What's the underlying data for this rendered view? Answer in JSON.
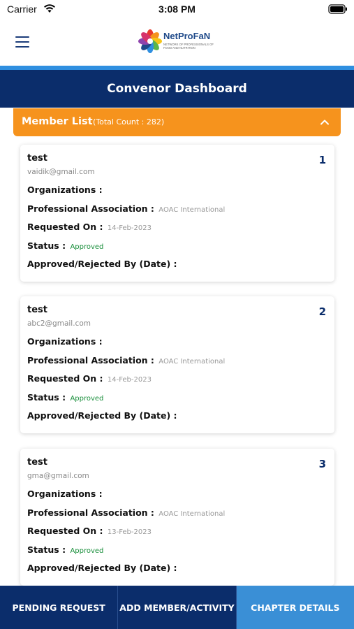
{
  "status_bar": {
    "carrier": "Carrier",
    "time": "3:08 PM"
  },
  "header": {
    "logo_title": "NetProFaN",
    "logo_subtitle": "NETWORK OF PROFESSIONALS OF FOOD AND NUTRITION"
  },
  "title": "Convenor Dashboard",
  "member_list": {
    "label": "Member List",
    "count_text": "(Total Count : 282)",
    "field_labels": {
      "organizations": "Organizations :",
      "professional_association": "Professional Association :",
      "requested_on": "Requested On :",
      "status": "Status :",
      "approved_by": "Approved/Rejected By (Date) :"
    },
    "members": [
      {
        "index": "1",
        "name": "test",
        "email": "vaidik@gmail.com",
        "association": "AOAC International",
        "requested_on": "14-Feb-2023",
        "status": "Approved"
      },
      {
        "index": "2",
        "name": "test",
        "email": "abc2@gmail.com",
        "association": "AOAC International",
        "requested_on": "14-Feb-2023",
        "status": "Approved"
      },
      {
        "index": "3",
        "name": "test",
        "email": "gma@gmail.com",
        "association": "AOAC International",
        "requested_on": "13-Feb-2023",
        "status": "Approved"
      }
    ]
  },
  "bottom_nav": [
    {
      "label": "PENDING REQUEST"
    },
    {
      "label": "ADD MEMBER/ACTIVITY"
    },
    {
      "label": "CHAPTER DETAILS"
    }
  ],
  "colors": {
    "navy": "#0b2d6b",
    "orange": "#f6931d",
    "accent_blue": "#3a8fd6",
    "approved_green": "#1a8f3c"
  }
}
